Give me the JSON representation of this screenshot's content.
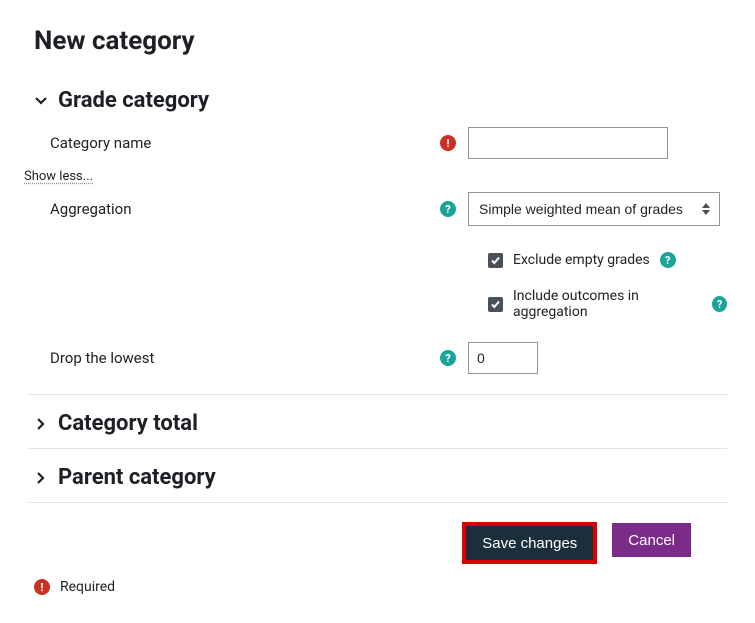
{
  "pageTitle": "New category",
  "showLessLabel": "Show less...",
  "sections": {
    "gradeCategory": {
      "title": "Grade category",
      "categoryName": {
        "label": "Category name",
        "value": ""
      },
      "aggregation": {
        "label": "Aggregation",
        "selected": "Simple weighted mean of grades"
      },
      "excludeEmpty": {
        "label": "Exclude empty grades",
        "checked": true
      },
      "includeOutcomes": {
        "label": "Include outcomes in aggregation",
        "checked": true
      },
      "dropLowest": {
        "label": "Drop the lowest",
        "value": "0"
      }
    },
    "categoryTotal": {
      "title": "Category total"
    },
    "parentCategory": {
      "title": "Parent category"
    }
  },
  "actions": {
    "save": "Save changes",
    "cancel": "Cancel"
  },
  "requiredLegend": "Required"
}
